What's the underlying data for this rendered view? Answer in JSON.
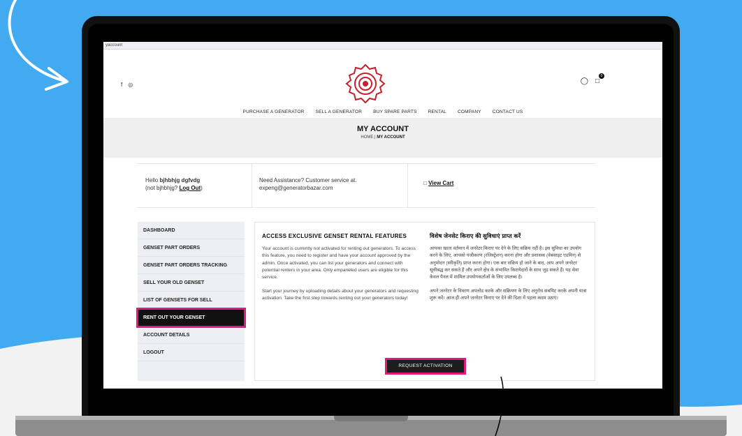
{
  "browser": {
    "url_fragment": "yaccount"
  },
  "header": {
    "social_icons": [
      "facebook-icon",
      "instagram-icon"
    ],
    "cart_count": "0"
  },
  "nav": {
    "items": [
      "PURCHASE A GENERATOR",
      "SELL A GENERATOR",
      "BUY SPARE PARTS",
      "RENTAL",
      "COMPANY",
      "CONTACT US"
    ]
  },
  "banner": {
    "title": "MY ACCOUNT",
    "crumb_home": "HOME",
    "crumb_sep": "|",
    "crumb_current": "MY ACCOUNT"
  },
  "info": {
    "hello_prefix": "Hello ",
    "username": "bjhbhjg dgfvdg",
    "not_prefix": "(not bjhbhjg? ",
    "logout": "Log Out",
    "not_suffix": ")",
    "assist_line1": "Need Assistance? Customer service at.",
    "assist_email": "expeng@generatorbazar.com",
    "view_cart": "View Cart"
  },
  "sidebar": {
    "items": [
      {
        "label": "DASHBOARD"
      },
      {
        "label": "GENSET PART ORDERS"
      },
      {
        "label": "GENSET PART ORDERS TRACKING"
      },
      {
        "label": "SELL YOUR OLD GENSET"
      },
      {
        "label": "LIST OF GENSETS FOR SELL"
      },
      {
        "label": "RENT OUT YOUR GENSET"
      },
      {
        "label": "ACCOUNT DETAILS"
      },
      {
        "label": "LOGOUT"
      }
    ],
    "active_index": 5
  },
  "content": {
    "en_title": "ACCESS EXCLUSIVE GENSET RENTAL FEATURES",
    "en_p1": "Your account is currently not activated for renting out generators. To access this feature, you need to register and have your account approved by the admin. Once activated, you can list your generators and connect with potential renters in your area. Only empaneled users are eligible for this service.",
    "en_p2": "Start your journey by uploading details about your generators and requesting activation. Take the first step towards renting out your generators today!",
    "hi_title": "विशेष जेनसेट किराए की सुविधाएं प्राप्त करें",
    "hi_p1": "आपका खाता वर्तमान में जनरेटर किराए पर देने के लिए सक्रिय नहीं है। इस सुविधा का उपयोग करने के लिए, आपको पंजीकरण (रजिस्ट्रेशन) करना होगा और प्रशासक (वेबसाइट एडमिन) से अनुमोदन (स्वीकृति) प्राप्त करना होगा। एक बार सक्रिय हो जाने के बाद, आप अपने जनरेटर सूचीबद्ध कर सकते हैं और अपने क्षेत्र के संभावित किरायेदारों के साथ जुड़ सकते हैं। यह सेवा केवल पैनल में शामिल उपयोगकर्ताओं के लिए उपलब्ध है।",
    "hi_p2": "अपने जनरेटर के विवरण अपलोड करके और सक्रियण के लिए अनुरोध सबमिट करके अपनी यात्रा शुरू करें। आज ही अपने जनरेटर किराए पर देने की दिशा में पहला कदम उठाएं।",
    "button": "REQUEST ACTIVATION"
  },
  "colors": {
    "accent": "#e0197b",
    "brand_red": "#c8202a",
    "background": "#41aaf0"
  }
}
